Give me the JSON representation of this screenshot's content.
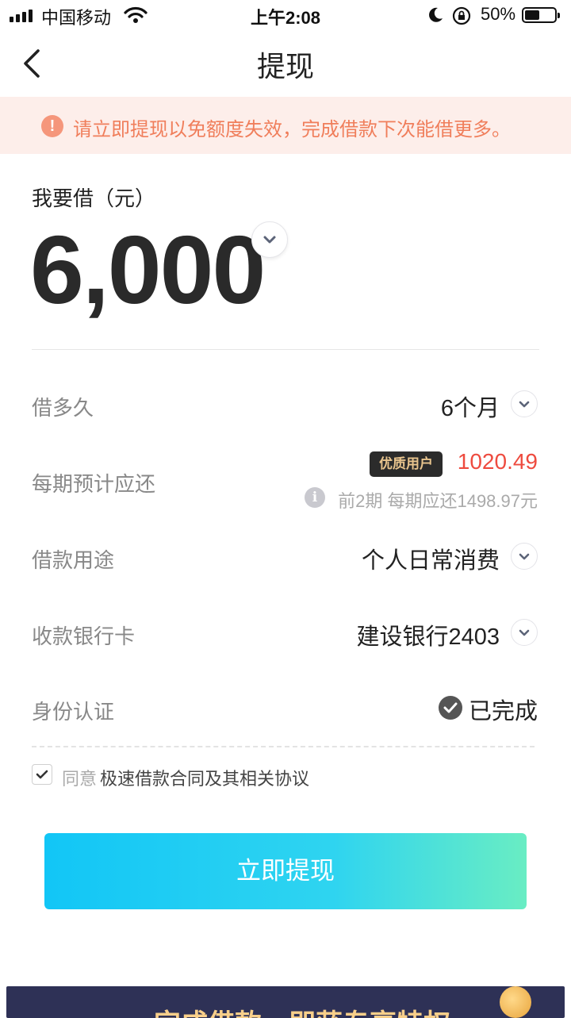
{
  "status_bar": {
    "carrier": "中国移动",
    "time": "上午2:08",
    "battery": "50%",
    "battery_level": 0.5
  },
  "nav": {
    "title": "提现"
  },
  "banner": {
    "icon": "!",
    "text": "请立即提现以免额度失效，完成借款下次能借更多。"
  },
  "amount": {
    "label": "我要借（元）",
    "value": "6,000"
  },
  "rows": {
    "term": {
      "label": "借多久",
      "value": "6个月"
    },
    "payment": {
      "label": "每期预计应还",
      "badge": "优质用户",
      "amount": "1020.49",
      "note": "前2期 每期应还1498.97元"
    },
    "purpose": {
      "label": "借款用途",
      "value": "个人日常消费"
    },
    "card": {
      "label": "收款银行卡",
      "value": "建设银行2403"
    },
    "identity": {
      "label": "身份认证",
      "value": "已完成"
    }
  },
  "agreement": {
    "agree": "同意",
    "link": "极速借款合同及其相关协议",
    "checked": true
  },
  "cta": {
    "label": "立即提现"
  },
  "promo": {
    "text": "完成借款，即获专享特权"
  },
  "colors": {
    "accent_red": "#ee4b3f",
    "banner_text": "#f07e5b",
    "cta_start": "#12c6f6",
    "cta_end": "#69edc3"
  },
  "icons": [
    "signal-icon",
    "wifi-icon",
    "moon-icon",
    "rotation-lock-icon",
    "battery-icon",
    "back-icon",
    "warning-icon",
    "chevron-down-icon",
    "info-icon",
    "check-circle-icon",
    "checkbox-check-icon",
    "coin-icon"
  ]
}
